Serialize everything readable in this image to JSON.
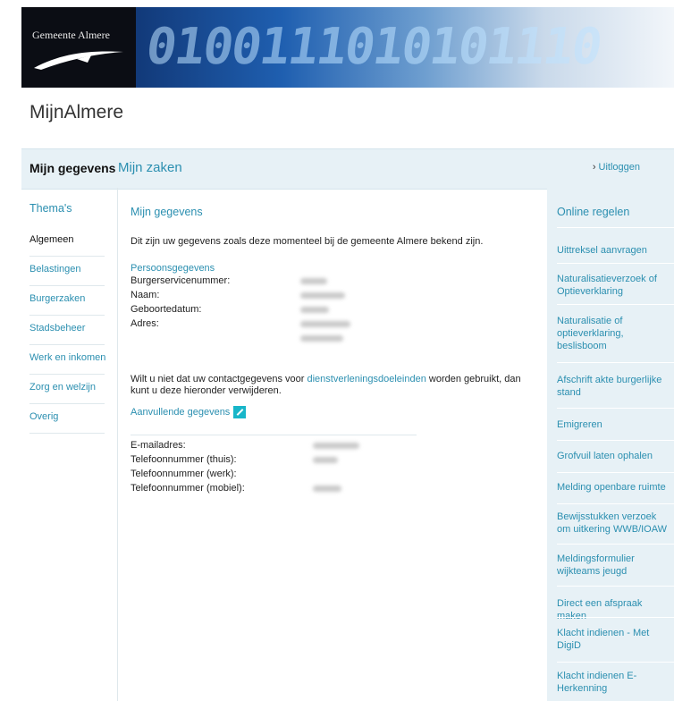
{
  "header": {
    "logo_text": "Gemeente Almere",
    "banner_binary": "0100111010101110"
  },
  "site": {
    "title": "MijnAlmere"
  },
  "tabs": {
    "active_label": "Mijn gegevens",
    "zaken_label": "Mijn zaken",
    "logout_label": "Uitloggen"
  },
  "sidebar": {
    "heading": "Thema's",
    "items": [
      {
        "label": "Algemeen"
      },
      {
        "label": "Belastingen"
      },
      {
        "label": "Burgerzaken"
      },
      {
        "label": "Stadsbeheer"
      },
      {
        "label": "Werk en inkomen"
      },
      {
        "label": "Zorg en welzijn"
      },
      {
        "label": "Overig"
      }
    ]
  },
  "main": {
    "heading": "Mijn gegevens",
    "intro": "Dit zijn uw gegevens zoals deze momenteel bij de gemeente Almere bekend zijn.",
    "persons_title": "Persoonsgegevens",
    "persons": [
      {
        "label": "Burgerservicenummer:"
      },
      {
        "label": "Naam:"
      },
      {
        "label": "Geboortedatum:"
      },
      {
        "label": "Adres:"
      }
    ],
    "notice_before": "Wilt u niet dat uw contactgegevens voor ",
    "notice_link": "dienstverleningsdoeleinden",
    "notice_after": " worden gebruikt, dan kunt u deze hieronder verwijderen.",
    "extra_title": "Aanvullende gegevens",
    "contacts": [
      {
        "label": "E-mailadres:"
      },
      {
        "label": "Telefoonnummer (thuis):"
      },
      {
        "label": "Telefoonnummer (werk):"
      },
      {
        "label": "Telefoonnummer (mobiel):"
      }
    ]
  },
  "right": {
    "heading": "Online regelen",
    "items": [
      {
        "label": "Uittreksel aanvragen"
      },
      {
        "label": "Naturalisatieverzoek of Optieverklaring"
      },
      {
        "label": "Naturalisatie of optieverklaring, beslisboom"
      },
      {
        "label": "Afschrift akte burgerlijke stand"
      },
      {
        "label": "Emigreren"
      },
      {
        "label": "Grofvuil laten ophalen"
      },
      {
        "label": "Melding openbare ruimte"
      },
      {
        "label": "Bewijsstukken verzoek om uitkering WWB/IOAW"
      },
      {
        "label": "Meldingsformulier wijkteams jeugd"
      },
      {
        "label": "Direct een afspraak maken"
      },
      {
        "label": "Klacht indienen - Met DigiD"
      },
      {
        "label": "Klacht indienen E-Herkenning"
      }
    ]
  },
  "colors": {
    "accent": "#2b8fb0",
    "panel": "#e7f1f6",
    "edit_icon": "#18b6c9"
  }
}
